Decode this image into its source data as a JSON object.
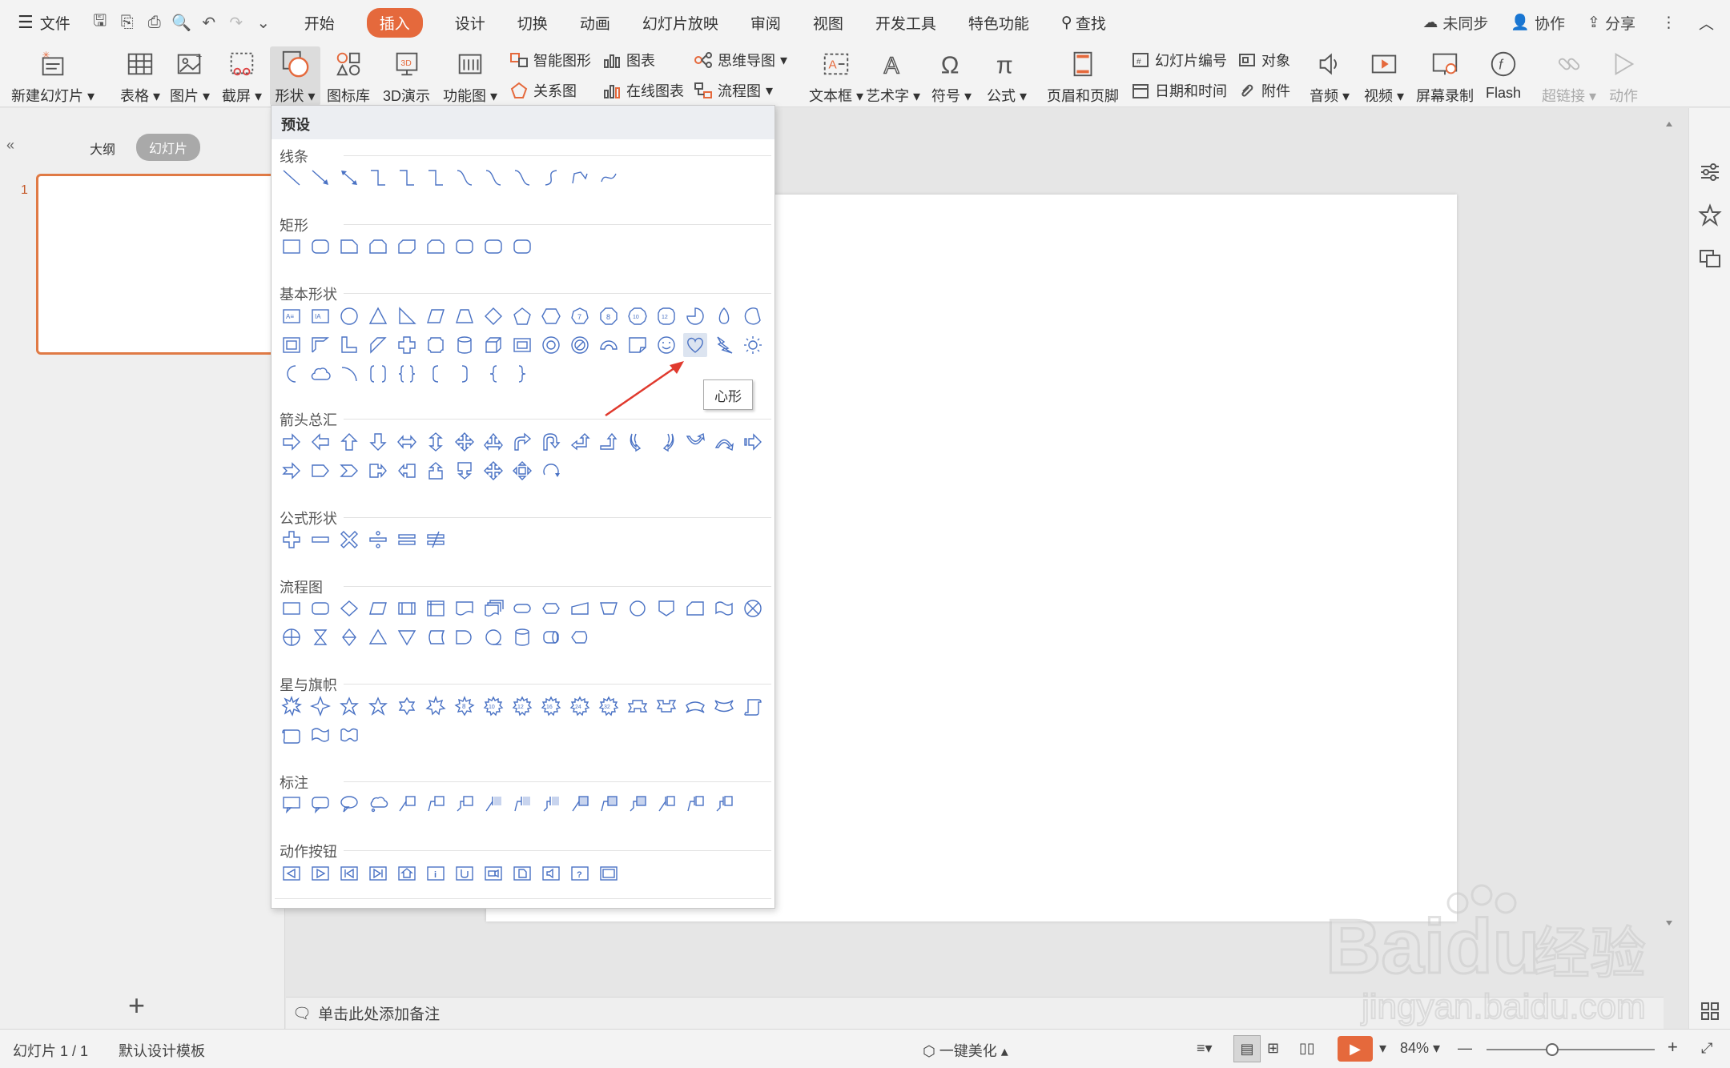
{
  "menubar": {
    "file_label": "文件",
    "tabs": [
      "开始",
      "插入",
      "设计",
      "切换",
      "动画",
      "幻灯片放映",
      "审阅",
      "视图",
      "开发工具",
      "特色功能"
    ],
    "active_tab": "插入",
    "search_label": "查找",
    "sync_label": "未同步",
    "collab_label": "协作",
    "share_label": "分享"
  },
  "ribbon": {
    "new_slide": "新建幻灯片",
    "table": "表格",
    "picture": "图片",
    "screenshot": "截屏",
    "shape": "形状",
    "icon_lib": "图标库",
    "demo3d": "3D演示",
    "func_chart": "功能图",
    "smart_shape": "智能图形",
    "chart": "图表",
    "mindmap": "思维导图",
    "relation": "关系图",
    "online_chart": "在线图表",
    "flowchart": "流程图",
    "textbox": "文本框",
    "wordart": "艺术字",
    "symbol": "符号",
    "formula": "公式",
    "header_footer": "页眉和页脚",
    "slide_number": "幻灯片编号",
    "object": "对象",
    "datetime": "日期和时间",
    "attachment": "附件",
    "audio": "音频",
    "video": "视频",
    "screen_record": "屏幕录制",
    "flash": "Flash",
    "hyperlink": "超链接",
    "action": "动作"
  },
  "leftpanel": {
    "tab_outline": "大纲",
    "tab_slides": "幻灯片",
    "slide_number": "1"
  },
  "dropdown": {
    "header": "预设",
    "sections": [
      "线条",
      "矩形",
      "基本形状",
      "箭头总汇",
      "公式形状",
      "流程图",
      "星与旗帜",
      "标注",
      "动作按钮"
    ],
    "tooltip": "心形"
  },
  "notes": {
    "placeholder": "单击此处添加备注"
  },
  "statusbar": {
    "slide_info": "幻灯片 1 / 1",
    "template": "默认设计模板",
    "beautify": "一键美化",
    "zoom": "84%"
  },
  "watermark": {
    "brand": "Bai",
    "brand2": "du",
    "cn": "经验",
    "url": "jingyan.baidu.com"
  },
  "colors": {
    "accent": "#e5693c",
    "shape_stroke": "#4a72c4"
  }
}
